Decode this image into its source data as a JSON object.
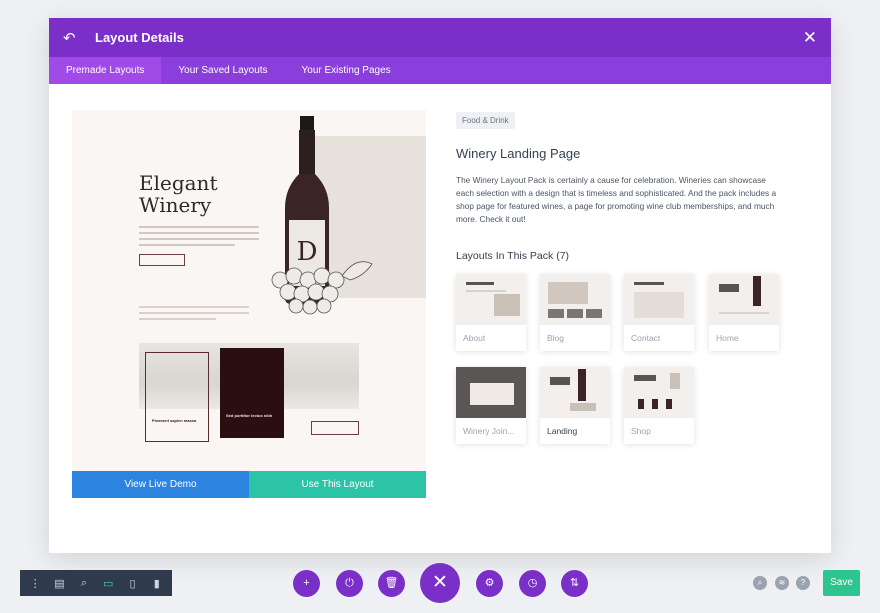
{
  "modal": {
    "title": "Layout Details",
    "tabs": [
      {
        "label": "Premade Layouts"
      },
      {
        "label": "Your Saved Layouts"
      },
      {
        "label": "Your Existing Pages"
      }
    ]
  },
  "preview": {
    "hero_title_line1": "Elegant",
    "hero_title_line2": "Winery",
    "card1_title": "Praesent sapien massa",
    "card2_title": "Sed porttitor lectus nibh",
    "view_demo_label": "View Live Demo",
    "use_layout_label": "Use This Layout"
  },
  "details": {
    "category": "Food & Drink",
    "name": "Winery Landing Page",
    "description": "The Winery Layout Pack is certainly a cause for celebration. Wineries can showcase each selection with a design that is timeless and sophisticated. And the pack includes a shop page for featured wines, a page for promoting wine club memberships, and much more. Check it out!",
    "pack_heading": "Layouts In This Pack (7)"
  },
  "layouts": [
    {
      "label": "About"
    },
    {
      "label": "Blog"
    },
    {
      "label": "Contact"
    },
    {
      "label": "Home"
    },
    {
      "label": "Winery Join..."
    },
    {
      "label": "Landing"
    },
    {
      "label": "Shop"
    }
  ],
  "toolbar": {
    "save_label": "Save",
    "close_icon_glyph": "✕"
  },
  "colors": {
    "header": "#7b2fc9",
    "demo_button": "#2c83e0",
    "use_button": "#2cc4a7",
    "save_button": "#2cc48f"
  }
}
